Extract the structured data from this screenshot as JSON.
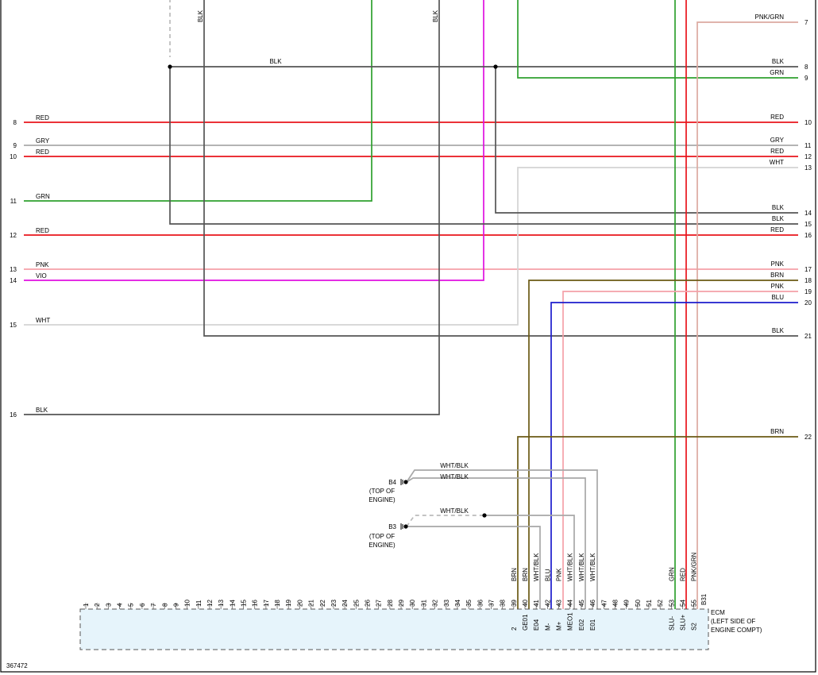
{
  "diagram_id": "367472",
  "colors": {
    "RED": "#e8141c",
    "GRY": "#a9a9a9",
    "GRN": "#2ea02e",
    "BLK": "#555555",
    "PNK": "#f4a0a8",
    "VIO": "#e010e0",
    "WHT": "#d4d4d4",
    "BRN": "#6b5a14",
    "BLU": "#1c1ccc",
    "PNK/GRN": "#dcaaa0",
    "WHT/BLK": "#a8a8a8"
  },
  "left_pins": [
    {
      "num": "8",
      "label": "RED"
    },
    {
      "num": "9",
      "label": "GRY"
    },
    {
      "num": "10",
      "label": "RED"
    },
    {
      "num": "11",
      "label": "GRN"
    },
    {
      "num": "12",
      "label": "RED"
    },
    {
      "num": "13",
      "label": "PNK"
    },
    {
      "num": "14",
      "label": "VIO"
    },
    {
      "num": "15",
      "label": "WHT"
    },
    {
      "num": "16",
      "label": "BLK"
    }
  ],
  "right_pins": [
    {
      "num": "7",
      "label": "PNK/GRN"
    },
    {
      "num": "8",
      "label": "BLK"
    },
    {
      "num": "9",
      "label": "GRN"
    },
    {
      "num": "10",
      "label": "RED"
    },
    {
      "num": "11",
      "label": "GRY"
    },
    {
      "num": "12",
      "label": "RED"
    },
    {
      "num": "13",
      "label": "WHT"
    },
    {
      "num": "14",
      "label": "BLK"
    },
    {
      "num": "15",
      "label": "BLK"
    },
    {
      "num": "16",
      "label": "RED"
    },
    {
      "num": "17",
      "label": "PNK"
    },
    {
      "num": "18",
      "label": "BRN"
    },
    {
      "num": "19",
      "label": "PNK"
    },
    {
      "num": "20",
      "label": "BLU"
    },
    {
      "num": "21",
      "label": "BLK"
    },
    {
      "num": "22",
      "label": "BRN"
    }
  ],
  "wire_labels": {
    "top_blk_horizontal": "BLK",
    "top_vertical_1": "BLK",
    "top_vertical_2": "BLK",
    "wht_blk_1": "WHT/BLK",
    "wht_blk_2": "WHT/BLK",
    "wht_blk_3": "WHT/BLK"
  },
  "grounds": {
    "b4": {
      "id": "B4",
      "location_line1": "(TOP OF",
      "location_line2": "ENGINE)"
    },
    "b3": {
      "id": "B3",
      "location_line1": "(TOP OF",
      "location_line2": "ENGINE)"
    }
  },
  "ecm": {
    "connector": "B31",
    "name": "ECM",
    "location_line1": "(LEFT SIDE OF",
    "location_line2": "ENGINE COMPT)",
    "pins": [
      "1",
      "2",
      "3",
      "4",
      "5",
      "6",
      "7",
      "8",
      "9",
      "10",
      "11",
      "12",
      "13",
      "14",
      "15",
      "16",
      "17",
      "18",
      "19",
      "20",
      "21",
      "22",
      "23",
      "24",
      "25",
      "26",
      "27",
      "28",
      "29",
      "30",
      "31",
      "32",
      "33",
      "34",
      "35",
      "36",
      "37",
      "38",
      "39",
      "40",
      "41",
      "42",
      "43",
      "44",
      "45",
      "46",
      "47",
      "48",
      "49",
      "50",
      "51",
      "52",
      "53",
      "54",
      "55"
    ],
    "terminals": [
      {
        "pin": "39",
        "signal": "2",
        "wire": "BRN"
      },
      {
        "pin": "40",
        "signal": "GE01",
        "wire": "BRN"
      },
      {
        "pin": "41",
        "signal": "E04",
        "wire": "WHT/BLK"
      },
      {
        "pin": "42",
        "signal": "M-",
        "wire": "BLU"
      },
      {
        "pin": "43",
        "signal": "M+",
        "wire": "PNK"
      },
      {
        "pin": "44",
        "signal": "MEO1",
        "wire": "WHT/BLK"
      },
      {
        "pin": "45",
        "signal": "E02",
        "wire": "WHT/BLK"
      },
      {
        "pin": "46",
        "signal": "E01",
        "wire": "WHT/BLK"
      },
      {
        "pin": "53",
        "signal": "SLU-",
        "wire": "GRN"
      },
      {
        "pin": "54",
        "signal": "SLU+",
        "wire": "RED"
      },
      {
        "pin": "55",
        "signal": "S2",
        "wire": "PNK/GRN"
      }
    ]
  }
}
